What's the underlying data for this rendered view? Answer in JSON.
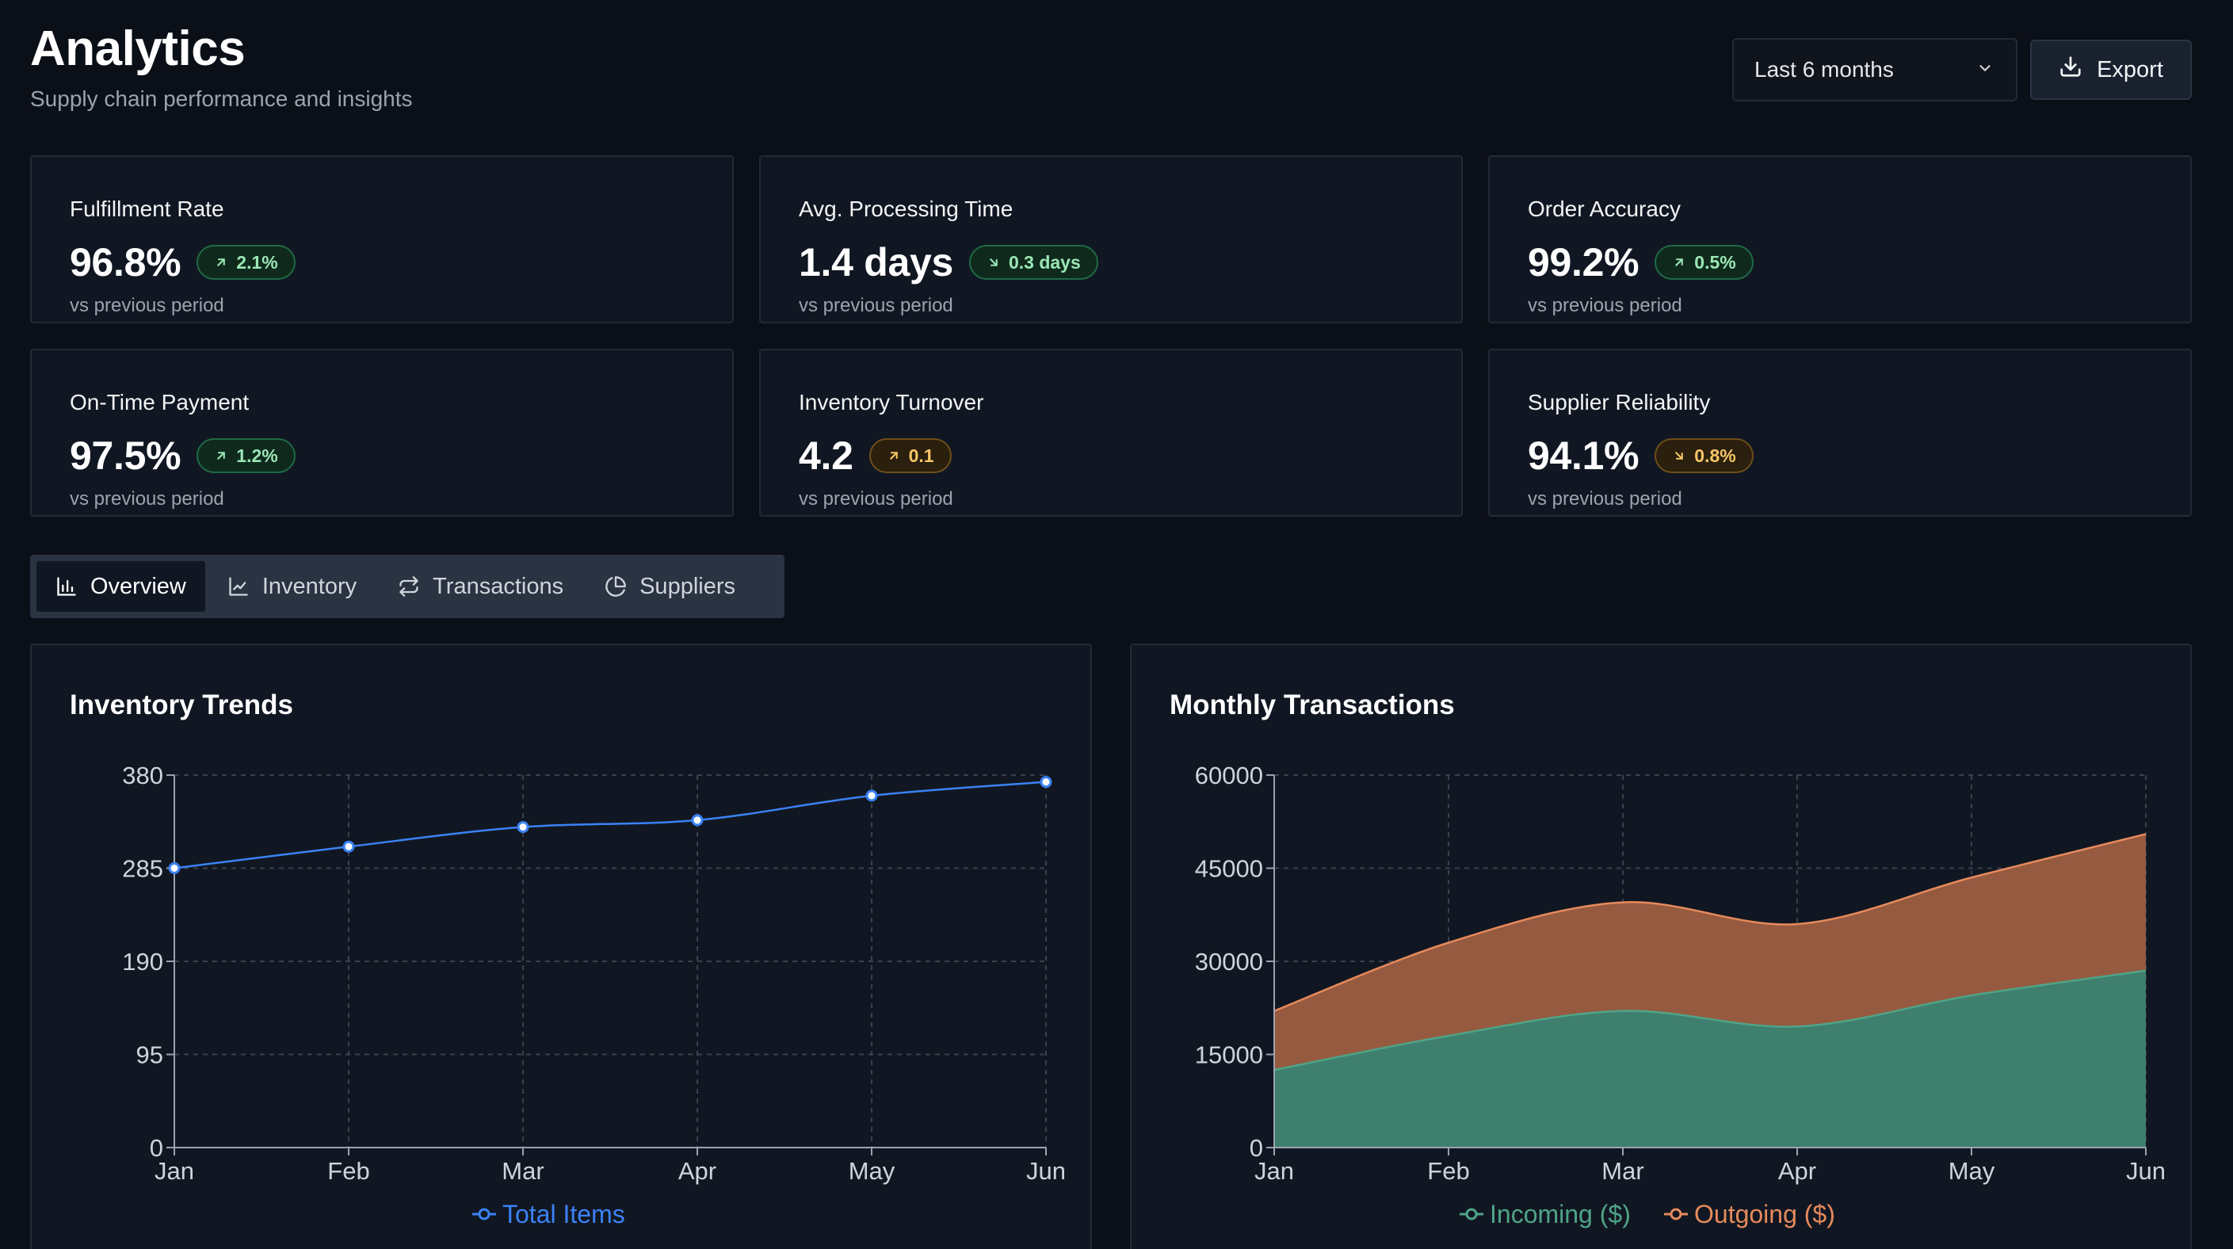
{
  "header": {
    "title": "Analytics",
    "subtitle": "Supply chain performance and insights",
    "range_select": "Last 6 months",
    "export_label": "Export"
  },
  "kpis": [
    {
      "label": "Fulfillment Rate",
      "value": "96.8%",
      "change": "2.1%",
      "direction": "up",
      "tone": "good",
      "foot": "vs previous period"
    },
    {
      "label": "Avg. Processing Time",
      "value": "1.4 days",
      "change": "0.3 days",
      "direction": "down",
      "tone": "good",
      "foot": "vs previous period"
    },
    {
      "label": "Order Accuracy",
      "value": "99.2%",
      "change": "0.5%",
      "direction": "up",
      "tone": "good",
      "foot": "vs previous period"
    },
    {
      "label": "On-Time Payment",
      "value": "97.5%",
      "change": "1.2%",
      "direction": "up",
      "tone": "good",
      "foot": "vs previous period"
    },
    {
      "label": "Inventory Turnover",
      "value": "4.2",
      "change": "0.1",
      "direction": "up",
      "tone": "warn",
      "foot": "vs previous period"
    },
    {
      "label": "Supplier Reliability",
      "value": "94.1%",
      "change": "0.8%",
      "direction": "down",
      "tone": "warn",
      "foot": "vs previous period"
    }
  ],
  "tabs": [
    {
      "label": "Overview",
      "icon": "bar-chart-icon",
      "active": true
    },
    {
      "label": "Inventory",
      "icon": "line-chart-icon",
      "active": false
    },
    {
      "label": "Transactions",
      "icon": "repeat-icon",
      "active": false
    },
    {
      "label": "Suppliers",
      "icon": "pie-chart-icon",
      "active": false
    }
  ],
  "colors": {
    "line_series": "#3b82f6",
    "incoming": "#3f7f6e",
    "incoming_stroke": "#4fa487",
    "outgoing": "#955a40",
    "outgoing_stroke": "#e68a5c",
    "good": "#9ae6b4",
    "warn": "#f6c667"
  },
  "chart_data": [
    {
      "type": "line",
      "title": "Inventory Trends",
      "categories": [
        "Jan",
        "Feb",
        "Mar",
        "Apr",
        "May",
        "Jun"
      ],
      "series": [
        {
          "name": "Total Items",
          "values": [
            285,
            307,
            327,
            334,
            359,
            373
          ]
        }
      ],
      "ylim": [
        0,
        380
      ],
      "yticks": [
        0,
        95,
        190,
        285,
        380
      ],
      "grid": true,
      "legend": "bottom-center"
    },
    {
      "type": "area",
      "stacked": true,
      "title": "Monthly Transactions",
      "categories": [
        "Jan",
        "Feb",
        "Mar",
        "Apr",
        "May",
        "Jun"
      ],
      "series": [
        {
          "name": "Incoming ($)",
          "values": [
            12500,
            18000,
            22000,
            19500,
            24500,
            28500
          ]
        },
        {
          "name": "Outgoing ($)",
          "values": [
            9500,
            15000,
            17500,
            16500,
            19000,
            22000
          ]
        }
      ],
      "ylim": [
        0,
        60000
      ],
      "yticks": [
        0,
        15000,
        30000,
        45000,
        60000
      ],
      "grid": true,
      "legend": "bottom-center"
    }
  ]
}
